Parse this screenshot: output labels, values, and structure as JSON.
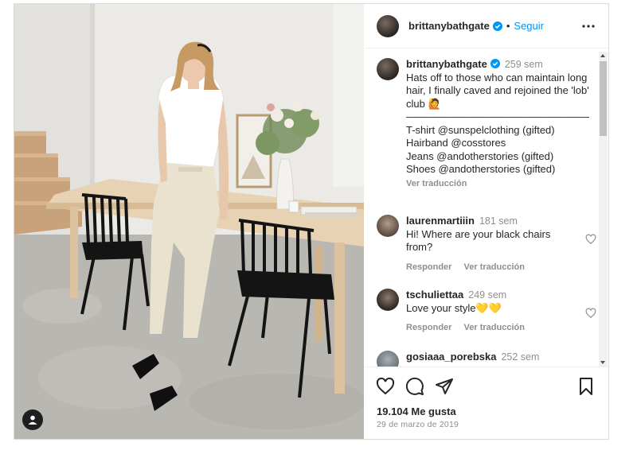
{
  "post": {
    "author": {
      "username": "brittanybathgate",
      "follow_label": "Seguir",
      "separator": "•"
    },
    "caption": {
      "username": "brittanybathgate",
      "time": "259 sem",
      "text": "Hats off to those who can maintain long hair, I finally caved and rejoined the 'lob' club 🙋",
      "separator_line": "——————————————————————————————",
      "credits": [
        "T-shirt @sunspelclothing (gifted)",
        "Hairband @cosstores",
        "Jeans @andotherstories (gifted)",
        "Shoes @andotherstories (gifted)"
      ],
      "translate_label": "Ver traducción"
    },
    "comments": [
      {
        "username": "laurenmartiiin",
        "time": "181 sem",
        "text": "Hi! Where are your black chairs from?",
        "reply_label": "Responder",
        "translate_label": "Ver traducción"
      },
      {
        "username": "tschuliettaa",
        "time": "249 sem",
        "text": "Love your style💛💛",
        "reply_label": "Responder",
        "translate_label": "Ver traducción"
      },
      {
        "username": "gosiaaa_porebska",
        "time": "252 sem",
        "text": ""
      }
    ],
    "likes": "19.104 Me gusta",
    "date": "29 de marzo de 2019"
  },
  "icons": {
    "more": "more-options-icon",
    "verified": "verified-badge-icon",
    "like": "heart-icon",
    "comment": "comment-icon",
    "share": "send-icon",
    "save": "bookmark-icon",
    "tag": "user-tag-icon"
  },
  "colors": {
    "link": "#0095f6",
    "verified": "#0095f6",
    "muted": "#8e8e8e",
    "text": "#262626"
  }
}
